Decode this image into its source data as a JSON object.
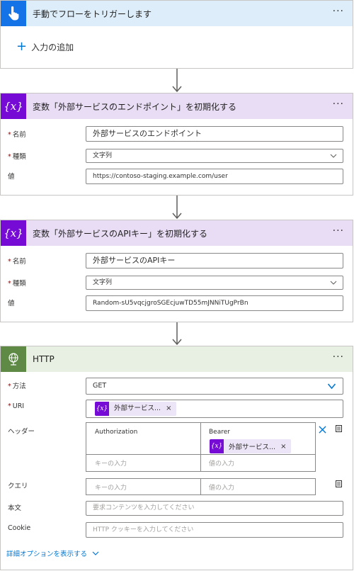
{
  "trigger": {
    "title": "手動でフローをトリガーします",
    "more": "···",
    "add_input": "入力の追加",
    "color": "#0f6cbd"
  },
  "var1": {
    "title": "変数「外部サービスのエンドポイント」を初期化する",
    "more": "···",
    "name_label": "名前",
    "name_value": "外部サービスのエンドポイント",
    "type_label": "種類",
    "type_value": "文字列",
    "value_label": "値",
    "value_value": "https://contoso-staging.example.com/user"
  },
  "var2": {
    "title": "変数「外部サービスのAPIキー」を初期化する",
    "more": "···",
    "name_label": "名前",
    "name_value": "外部サービスのAPIキー",
    "type_label": "種類",
    "type_value": "文字列",
    "value_label": "値",
    "value_value": "Random-sU5vqcjgroSGEcjuwTD55mJNNiTUgPrBn"
  },
  "http": {
    "title": "HTTP",
    "more": "···",
    "method_label": "方法",
    "method_value": "GET",
    "uri_label": "URI",
    "uri_token": "外部サービス...",
    "headers_label": "ヘッダー",
    "header_key": "Authorization",
    "header_value_prefix": "Bearer",
    "header_token": "外部サービス...",
    "key_placeholder": "キーの入力",
    "value_placeholder": "値の入力",
    "query_label": "クエリ",
    "body_label": "本文",
    "body_placeholder": "要求コンテンツを入力してください",
    "cookie_label": "Cookie",
    "cookie_placeholder": "HTTP クッキーを入力してください",
    "advanced": "詳細オプションを表示する"
  },
  "token_icon": "{x}",
  "remove": "×",
  "colors": {
    "trigger_header": "#ddeefa",
    "trigger_icon": "#1473e6",
    "variable_header": "#e8ddf5",
    "variable_icon": "#770bd6",
    "http_header": "#e8f0e4",
    "http_icon": "#5e8a45",
    "link": "#0078d4",
    "required": "#a80000"
  }
}
